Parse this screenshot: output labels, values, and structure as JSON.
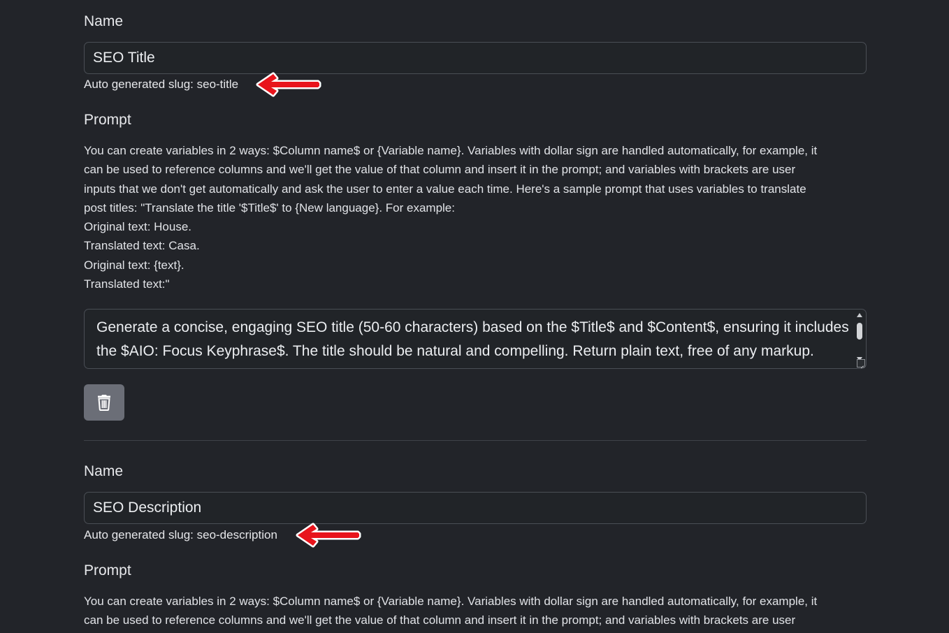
{
  "entries": [
    {
      "name_label": "Name",
      "name_value": "SEO Title",
      "slug_text": "Auto generated slug: seo-title",
      "prompt_label": "Prompt",
      "help_lines": [
        "You can create variables in 2 ways: $Column name$ or {Variable name}. Variables with dollar sign are handled automatically, for example, it",
        "can be used to reference columns and we'll get the value of that column and insert it in the prompt; and variables with brackets are user",
        "inputs that we don't get automatically and ask the user to enter a value each time. Here's a sample prompt that uses variables to translate",
        "post titles: \"Translate the title '$Title$' to {New language}. For example:",
        "Original text: House.",
        "Translated text: Casa.",
        "Original text: {text}.",
        "Translated text:\""
      ],
      "prompt_value": "Generate a concise, engaging SEO title (50-60 characters) based on the $Title$ and $Content$, ensuring it includes the $AIO: Focus Keyphrase$. The title should be natural and compelling. Return plain text, free of any markup.",
      "delete_icon": "trash-icon"
    },
    {
      "name_label": "Name",
      "name_value": "SEO Description",
      "slug_text": "Auto generated slug: seo-description",
      "prompt_label": "Prompt",
      "help_lines": [
        "You can create variables in 2 ways: $Column name$ or {Variable name}. Variables with dollar sign are handled automatically, for example, it",
        "can be used to reference columns and we'll get the value of that column and insert it in the prompt; and variables with brackets are user"
      ]
    }
  ],
  "annotation": {
    "arrow_icon": "red-arrow-left-icon",
    "arrow_color": "#e8141c"
  }
}
